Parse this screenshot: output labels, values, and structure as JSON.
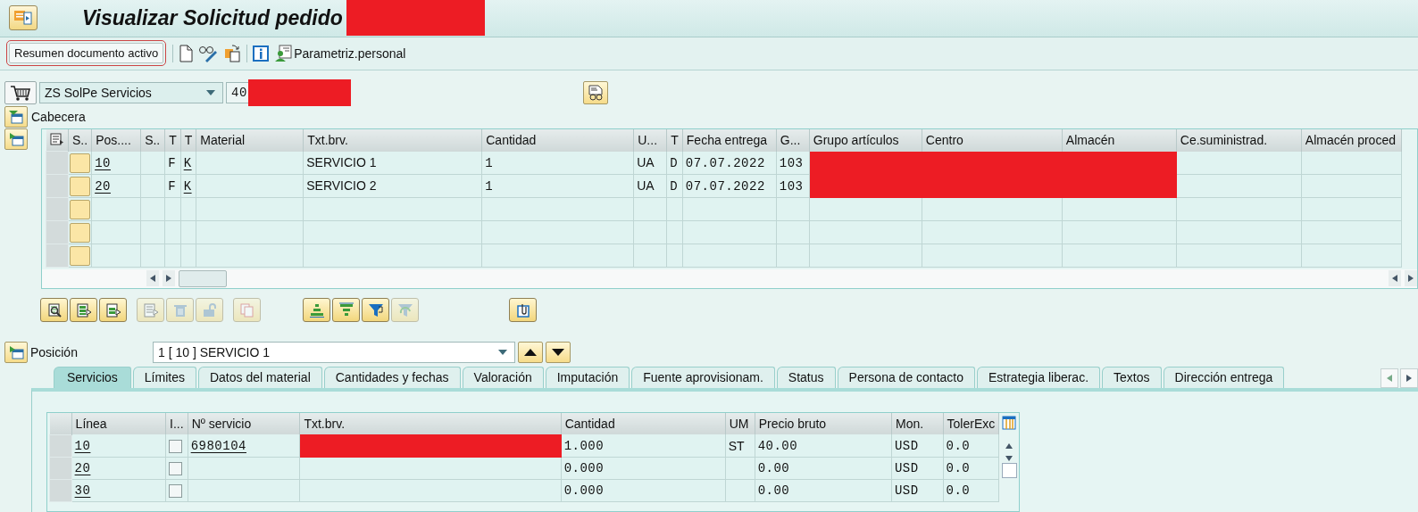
{
  "window": {
    "title": "Visualizar Solicitud pedido"
  },
  "app_toolbar": {
    "summary_button": "Resumen documento activo",
    "settings_button": "Parametriz.personal"
  },
  "document": {
    "type": "ZS SolPe Servicios",
    "number": "40"
  },
  "header_section": {
    "label": "Cabecera"
  },
  "items_table": {
    "columns": [
      {
        "label": "S..",
        "kind": "button"
      },
      {
        "label": "Pos....",
        "kind": "link"
      },
      {
        "label": "S..",
        "kind": "text"
      },
      {
        "label": "T",
        "kind": "mono"
      },
      {
        "label": "T",
        "kind": "link"
      },
      {
        "label": "Material",
        "kind": "text"
      },
      {
        "label": "Txt.brv.",
        "kind": "text"
      },
      {
        "label": "Cantidad",
        "kind": "mono"
      },
      {
        "label": "U...",
        "kind": "text"
      },
      {
        "label": "T",
        "kind": "mono"
      },
      {
        "label": "Fecha entrega",
        "kind": "mono"
      },
      {
        "label": "G...",
        "kind": "mono"
      },
      {
        "label": "Grupo artículos",
        "kind": "text"
      },
      {
        "label": "Centro",
        "kind": "text"
      },
      {
        "label": "Almacén",
        "kind": "text"
      },
      {
        "label": "Ce.suministrad.",
        "kind": "text"
      },
      {
        "label": "Almacén proced",
        "kind": "text"
      }
    ],
    "rows": [
      {
        "cells": [
          null,
          "10",
          null,
          "F",
          "K",
          null,
          "SERVICIO 1",
          "1",
          "UA",
          "D",
          "07.07.2022",
          "103",
          {
            "masked": true
          },
          {
            "masked": true
          },
          {
            "masked": true
          },
          null,
          null
        ]
      },
      {
        "cells": [
          null,
          "20",
          null,
          "F",
          "K",
          null,
          "SERVICIO 2",
          "1",
          "UA",
          "D",
          "07.07.2022",
          "103",
          {
            "masked": true
          },
          {
            "masked": true
          },
          {
            "masked": true
          },
          null,
          null
        ]
      }
    ]
  },
  "grid_toolbar": [
    {
      "kind": "details",
      "disabled": false
    },
    {
      "kind": "select-all",
      "disabled": false
    },
    {
      "kind": "select-block",
      "disabled": false
    },
    {
      "kind": "deselect",
      "disabled": true
    },
    {
      "kind": "delete",
      "disabled": true
    },
    {
      "kind": "unlock",
      "disabled": true
    },
    {
      "kind": "copy",
      "disabled": true
    },
    {
      "kind": "sort-ascending",
      "disabled": false
    },
    {
      "kind": "sort-descending",
      "disabled": false
    },
    {
      "kind": "filter",
      "disabled": false
    },
    {
      "kind": "reset-filter",
      "disabled": true
    },
    {
      "kind": "attachment",
      "disabled": false
    }
  ],
  "item_selector": {
    "label": "Posición",
    "value": "1 [ 10 ] SERVICIO 1"
  },
  "tabs": [
    {
      "label": "Servicios",
      "selected": true
    },
    {
      "label": "Límites",
      "selected": false
    },
    {
      "label": "Datos del material",
      "selected": false
    },
    {
      "label": "Cantidades y fechas",
      "selected": false
    },
    {
      "label": "Valoración",
      "selected": false
    },
    {
      "label": "Imputación",
      "selected": false
    },
    {
      "label": "Fuente aprovisionam.",
      "selected": false
    },
    {
      "label": "Status",
      "selected": false
    },
    {
      "label": "Persona de contacto",
      "selected": false
    },
    {
      "label": "Estrategia liberac.",
      "selected": false
    },
    {
      "label": "Textos",
      "selected": false
    },
    {
      "label": "Dirección entrega",
      "selected": false
    }
  ],
  "services_table": {
    "columns": [
      {
        "label": "Línea",
        "kind": "link"
      },
      {
        "label": "I...",
        "kind": "check"
      },
      {
        "label": "Nº servicio",
        "kind": "link"
      },
      {
        "label": "Txt.brv.",
        "kind": "text"
      },
      {
        "label": "Cantidad",
        "kind": "mono"
      },
      {
        "label": "UM",
        "kind": "text"
      },
      {
        "label": "Precio bruto",
        "kind": "mono"
      },
      {
        "label": "Mon.",
        "kind": "mono"
      },
      {
        "label": "TolerExc",
        "kind": "mono"
      }
    ],
    "rows": [
      {
        "checked": false,
        "cells": [
          "10",
          null,
          "6980104",
          {
            "masked": true
          },
          "1.000",
          "ST",
          "40.00",
          "USD",
          "0.0"
        ]
      },
      {
        "checked": false,
        "cells": [
          "20",
          null,
          null,
          null,
          "0.000",
          null,
          "0.00",
          "USD",
          "0.0"
        ]
      },
      {
        "checked": false,
        "cells": [
          "30",
          null,
          null,
          null,
          "0.000",
          null,
          "0.00",
          "USD",
          "0.0"
        ]
      }
    ]
  }
}
